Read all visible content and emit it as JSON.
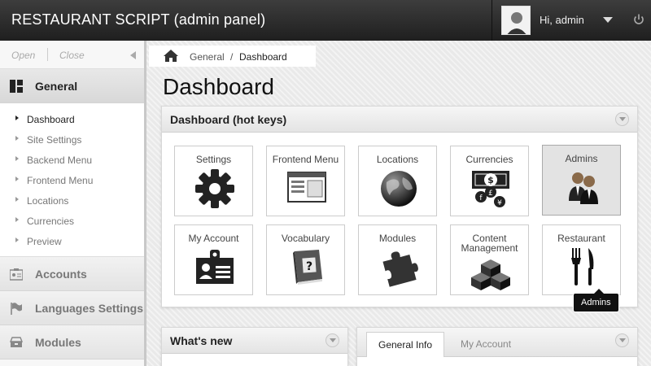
{
  "header": {
    "title": "RESTAURANT SCRIPT (admin panel)",
    "greeting": "Hi, admin"
  },
  "sidebar": {
    "open_label": "Open",
    "close_label": "Close",
    "sections": [
      {
        "label": "General",
        "icon": "dashboard-grid-icon",
        "active": true
      },
      {
        "label": "Accounts",
        "icon": "accounts-icon"
      },
      {
        "label": "Languages Settings",
        "icon": "flag-icon"
      },
      {
        "label": "Modules",
        "icon": "modules-icon"
      }
    ],
    "general_items": [
      {
        "label": "Dashboard",
        "current": true
      },
      {
        "label": "Site Settings"
      },
      {
        "label": "Backend Menu"
      },
      {
        "label": "Frontend Menu"
      },
      {
        "label": "Locations"
      },
      {
        "label": "Currencies"
      },
      {
        "label": "Preview"
      }
    ]
  },
  "breadcrumb": {
    "root": "General",
    "separator": "/",
    "current": "Dashboard"
  },
  "page": {
    "title": "Dashboard"
  },
  "hotkeys": {
    "title": "Dashboard (hot keys)",
    "tiles": [
      {
        "label": "Settings",
        "icon": "gear-icon"
      },
      {
        "label": "Frontend Menu",
        "icon": "frontend-menu-icon"
      },
      {
        "label": "Locations",
        "icon": "globe-icon"
      },
      {
        "label": "Currencies",
        "icon": "currencies-icon"
      },
      {
        "label": "Admins",
        "icon": "admins-icon",
        "hover": true
      },
      {
        "label": "My Account",
        "icon": "id-card-icon"
      },
      {
        "label": "Vocabulary",
        "icon": "vocabulary-book-icon"
      },
      {
        "label": "Modules",
        "icon": "puzzle-icon"
      },
      {
        "label": "Content Management",
        "icon": "cubes-icon"
      },
      {
        "label": "Restaurant",
        "icon": "fork-knife-icon"
      }
    ],
    "tooltip": "Admins"
  },
  "whats_new": {
    "title": "What's new"
  },
  "info_tabs": {
    "active": "General Info",
    "inactive": "My Account"
  }
}
